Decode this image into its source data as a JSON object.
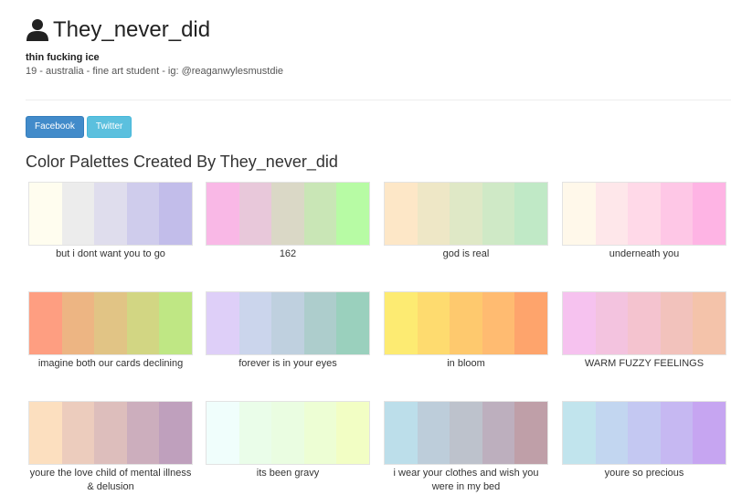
{
  "profile": {
    "username": "They_never_did",
    "tagline": "thin fucking ice",
    "bio": "19 - australia - fine art student - ig: @reaganwylesmustdie",
    "icon": "user-icon"
  },
  "social": {
    "facebook_label": "Facebook",
    "twitter_label": "Twitter"
  },
  "section_title": "Color Palettes Created By They_never_did",
  "palettes": [
    {
      "name": "but i dont want you to go",
      "colors": [
        "#fffdef",
        "#ececec",
        "#dfdded",
        "#cfccec",
        "#c2bdea"
      ]
    },
    {
      "name": "162",
      "colors": [
        "#f9b8e6",
        "#e8c8da",
        "#dad8c6",
        "#c9e6b6",
        "#b7fba4"
      ]
    },
    {
      "name": "god is real",
      "colors": [
        "#fde7c7",
        "#eee7c6",
        "#dfe8c6",
        "#cfe9c6",
        "#c0e9c6"
      ]
    },
    {
      "name": "underneath you",
      "colors": [
        "#fff8ea",
        "#fee7ea",
        "#ffd9e8",
        "#fec7e6",
        "#feb4e4"
      ]
    },
    {
      "name": "imagine both our cards declining",
      "colors": [
        "#fe9e81",
        "#edb583",
        "#e1c485",
        "#d2d683",
        "#bfe784"
      ]
    },
    {
      "name": "forever is in your eyes",
      "colors": [
        "#decff8",
        "#cbd5ec",
        "#bfd0df",
        "#adcdcc",
        "#9ad0bd"
      ]
    },
    {
      "name": "in bloom",
      "colors": [
        "#fdeb72",
        "#fedb6f",
        "#fec96e",
        "#ffbb71",
        "#fea46c"
      ]
    },
    {
      "name": "WARM FUZZY FEELINGS",
      "colors": [
        "#f6c2ef",
        "#f3c3df",
        "#f4c3cf",
        "#f2c2bc",
        "#f4c3aa"
      ]
    },
    {
      "name": "youre the love child of mental illness & delusion",
      "colors": [
        "#fcdfbf",
        "#ecccbd",
        "#ddbebc",
        "#ccaebd",
        "#bfa0bd"
      ]
    },
    {
      "name": "its been gravy",
      "colors": [
        "#f0fefc",
        "#eafde9",
        "#eafde1",
        "#edfed4",
        "#f2fec4"
      ]
    },
    {
      "name": "i wear your clothes and wish you were in my bed",
      "colors": [
        "#bcdeea",
        "#bdcdda",
        "#bdc2cc",
        "#bdafbe",
        "#bf9fa8"
      ]
    },
    {
      "name": "youre so precious",
      "colors": [
        "#c1e4ed",
        "#c2d6f0",
        "#c4c8f2",
        "#c6b8f2",
        "#c6a5f1"
      ]
    }
  ]
}
